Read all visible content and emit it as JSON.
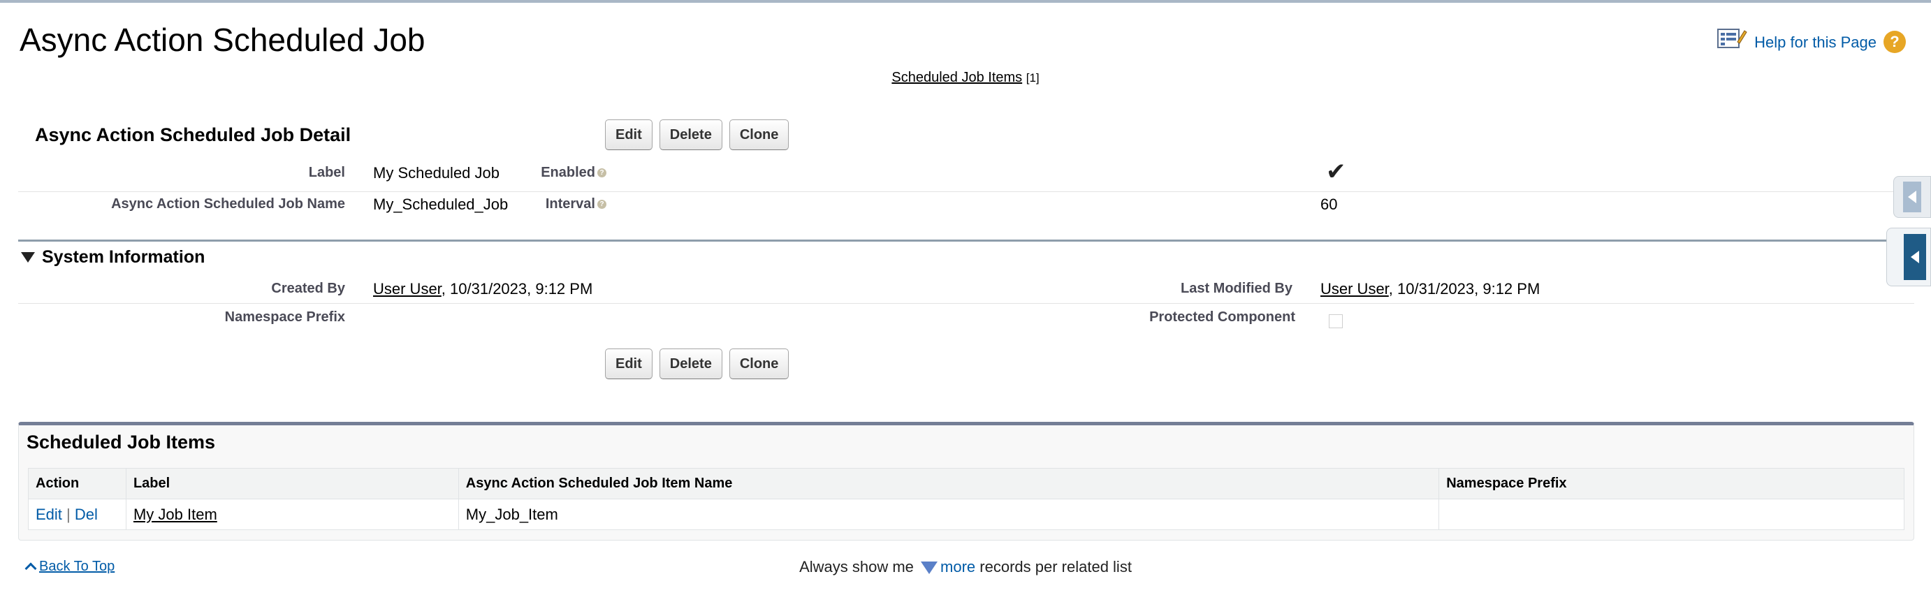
{
  "header": {
    "title": "Async Action Scheduled Job",
    "help_label": "Help for this Page",
    "help_badge": "?"
  },
  "top_links": {
    "scheduled_job_items_label": "Scheduled Job Items",
    "scheduled_job_items_count": "[1]"
  },
  "detail": {
    "title": "Async Action Scheduled Job Detail",
    "buttons": {
      "edit": "Edit",
      "delete": "Delete",
      "clone": "Clone"
    },
    "fields": {
      "label_label": "Label",
      "label_value": "My Scheduled Job",
      "name_label": "Async Action Scheduled Job Name",
      "name_value": "My_Scheduled_Job",
      "enabled_label": "Enabled",
      "enabled_checked": true,
      "enabled_check_glyph": "✔",
      "interval_label": "Interval",
      "interval_value": "60",
      "info_glyph": "?"
    }
  },
  "system_info": {
    "title": "System Information",
    "created_by_label": "Created By",
    "created_by_user": "User User",
    "created_by_date": ", 10/31/2023, 9:12 PM",
    "last_modified_label": "Last Modified By",
    "last_modified_user": "User User",
    "last_modified_date": ", 10/31/2023, 9:12 PM",
    "namespace_label": "Namespace Prefix",
    "protected_label": "Protected Component",
    "protected_checked": false
  },
  "related_list": {
    "title": "Scheduled Job Items",
    "columns": [
      "Action",
      "Label",
      "Async Action Scheduled Job Item Name",
      "Namespace Prefix"
    ],
    "rows": [
      {
        "edit": "Edit",
        "sep": " | ",
        "del": "Del",
        "label": "My Job Item",
        "name": "My_Job_Item",
        "namespace": ""
      }
    ]
  },
  "footer": {
    "back_to_top": "Back To Top",
    "always_show_prefix": "Always show me",
    "more_link": "more",
    "always_show_suffix": "records per related list"
  },
  "colors": {
    "link": "#015ba7",
    "section_bar": "#8e9dab",
    "related_header": "#747e96",
    "help_badge": "#e7a625"
  }
}
